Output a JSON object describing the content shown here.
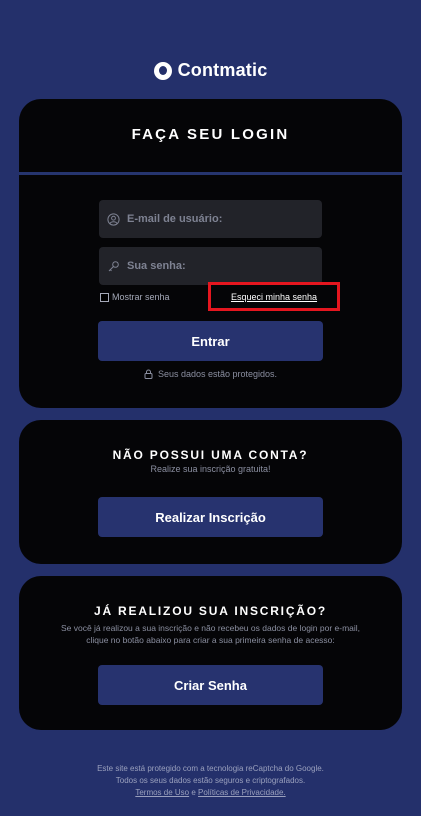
{
  "brand": {
    "name": "Contmatic"
  },
  "login": {
    "title": "FAÇA SEU LOGIN",
    "email_placeholder": "E-mail de usuário:",
    "password_placeholder": "Sua senha:",
    "show_password_label": "Mostrar senha",
    "forgot_password_label": "Esqueci minha senha",
    "submit_label": "Entrar",
    "secure_note": "Seus dados estão protegidos."
  },
  "signup": {
    "title": "NÃO POSSUI UMA CONTA?",
    "subtitle": "Realize sua inscrição gratuita!",
    "button_label": "Realizar Inscrição"
  },
  "create_password": {
    "title": "JÁ REALIZOU SUA INSCRIÇÃO?",
    "description_line1": "Se você já realizou a sua inscrição e não recebeu os dados de login por e-mail,",
    "description_line2": "clique no botão abaixo para criar a sua primeira senha de acesso:",
    "button_label": "Criar Senha"
  },
  "footer": {
    "line1": "Este site está protegido com a tecnologia reCaptcha do Google.",
    "line2": "Todos os seus dados estão seguros e criptografados.",
    "terms_link": "Termos de Uso",
    "conjunction": "e",
    "privacy_link": "Políticas de Privacidade."
  },
  "colors": {
    "background": "#24306b",
    "card": "#050507",
    "button": "#27336f",
    "highlight": "#e5161f"
  }
}
